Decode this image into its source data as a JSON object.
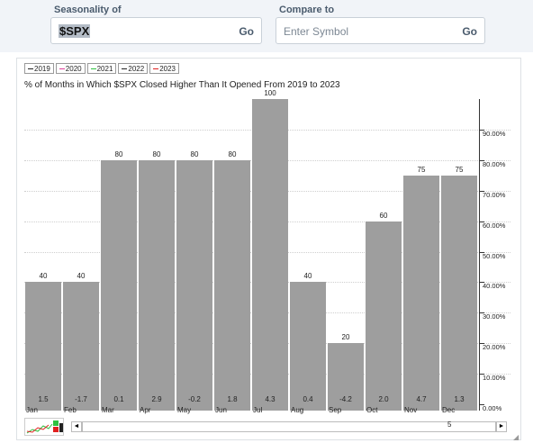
{
  "header": {
    "seasonality_label": "Seasonality of",
    "seasonality_value": "$SPX",
    "go_label": "Go",
    "compare_label": "Compare to",
    "compare_placeholder": "Enter Symbol",
    "compare_go_label": "Go"
  },
  "legend": [
    {
      "label": "2019",
      "color": "#222222"
    },
    {
      "label": "2020",
      "color": "#e0409a"
    },
    {
      "label": "2021",
      "color": "#2ec240"
    },
    {
      "label": "2022",
      "color": "#222222"
    },
    {
      "label": "2023",
      "color": "#e02020"
    }
  ],
  "chart_data": {
    "type": "bar",
    "title": "% of Months in Which $SPX Closed Higher Than It Opened From 2019 to 2023",
    "categories": [
      "Jan",
      "Feb",
      "Mar",
      "Apr",
      "May",
      "Jun",
      "Jul",
      "Aug",
      "Sep",
      "Oct",
      "Nov",
      "Dec"
    ],
    "values": [
      40,
      40,
      80,
      80,
      80,
      80,
      100,
      40,
      20,
      60,
      75,
      75
    ],
    "avg_change": [
      "1.5",
      "-1.7",
      "0.1",
      "2.9",
      "-0.2",
      "1.8",
      "4.3",
      "0.4",
      "-4.2",
      "2.0",
      "4.7",
      "1.3"
    ],
    "ylim": [
      0,
      100
    ],
    "yticks": [
      "0.00%",
      "10.00%",
      "20.00%",
      "30.00%",
      "40.00%",
      "50.00%",
      "60.00%",
      "70.00%",
      "80.00%",
      "90.00%"
    ],
    "bar_color": "#9e9e9e",
    "grid": true
  },
  "footer": {
    "left_arrow": "◄",
    "right_arrow": "►",
    "scroll_value": "5"
  }
}
